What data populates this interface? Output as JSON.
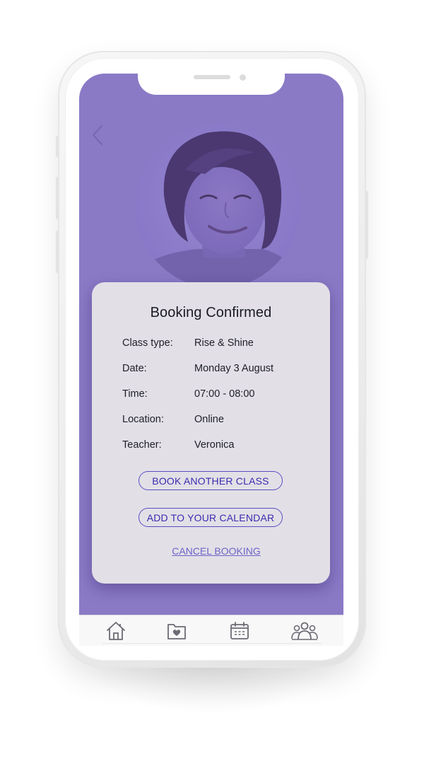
{
  "card": {
    "title": "Booking Confirmed",
    "rows": [
      {
        "label": "Class type:",
        "value": "Rise & Shine"
      },
      {
        "label": "Date:",
        "value": "Monday 3 August"
      },
      {
        "label": "Time:",
        "value": "07:00 - 08:00"
      },
      {
        "label": "Location:",
        "value": "Online"
      },
      {
        "label": "Teacher:",
        "value": "Veronica"
      }
    ],
    "book_another_label": "BOOK ANOTHER CLASS",
    "add_calendar_label": "ADD TO YOUR CALENDAR",
    "cancel_label": "CANCEL BOOKING"
  },
  "colors": {
    "screen_background": "#8a7ac6",
    "card_background": "#e2e0e6",
    "accent": "#5b4cc4",
    "link": "#6e62c8",
    "tab_icon": "#6b6b73"
  },
  "icons": {
    "back": "chevron-left-icon",
    "home": "home-icon",
    "favorites": "heart-folder-icon",
    "calendar": "calendar-icon",
    "community": "people-icon"
  }
}
